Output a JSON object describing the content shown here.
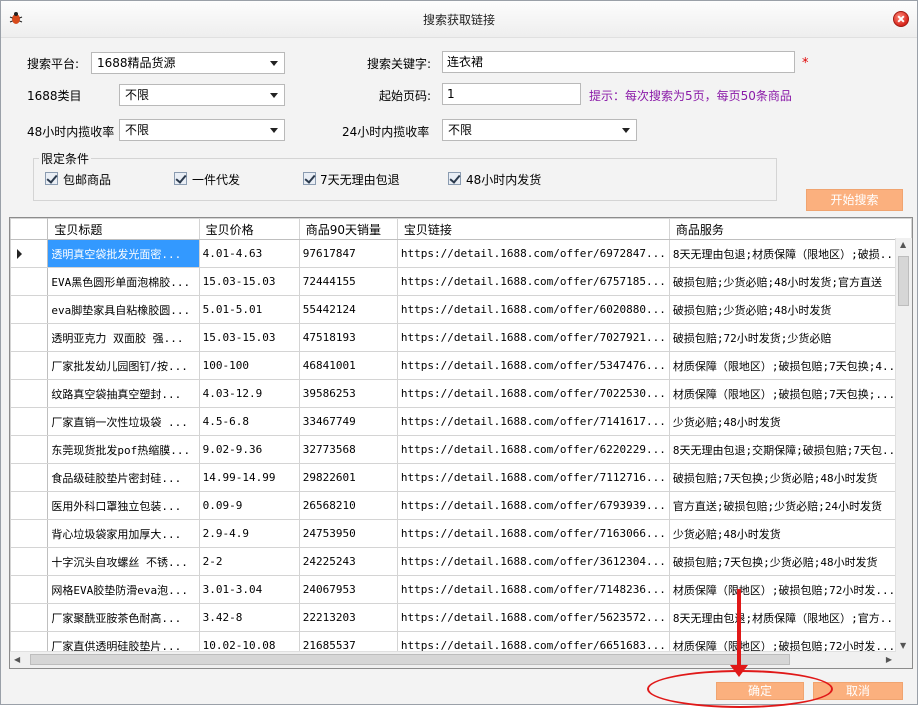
{
  "window": {
    "title": "搜索获取链接"
  },
  "form": {
    "platform_label": "搜索平台:",
    "platform_value": "1688精品货源",
    "keyword_label": "搜索关键字:",
    "keyword_value": "连衣裙",
    "required_mark": "*",
    "category_label": "1688类目",
    "category_value": "不限",
    "start_page_label": "起始页码:",
    "start_page_value": "1",
    "hint": "提示：每次搜索为5页，每页50条商品",
    "rate48_label": "48小时内揽收率",
    "rate48_value": "不限",
    "rate24_label": "24小时内揽收率",
    "rate24_value": "不限"
  },
  "conditions": {
    "title": "限定条件",
    "items": [
      {
        "label": "包邮商品",
        "checked": true
      },
      {
        "label": "一件代发",
        "checked": true
      },
      {
        "label": "7天无理由包退",
        "checked": true
      },
      {
        "label": "48小时内发货",
        "checked": true
      }
    ]
  },
  "start_search_button": "开始搜索",
  "grid": {
    "columns": [
      "宝贝标题",
      "宝贝价格",
      "商品90天销量",
      "宝贝链接",
      "商品服务"
    ],
    "rows": [
      [
        "透明真空袋批发光面密...",
        "4.01-4.63",
        "97617847",
        "https://detail.1688.com/offer/6972847...",
        "8天无理由包退;材质保障（限地区）;破损..."
      ],
      [
        "EVA黑色圆形单面泡棉胶...",
        "15.03-15.03",
        "72444155",
        "https://detail.1688.com/offer/6757185...",
        "破损包赔;少货必赔;48小时发货;官方直送"
      ],
      [
        "eva脚垫家具自粘橡胶圆...",
        "5.01-5.01",
        "55442124",
        "https://detail.1688.com/offer/6020880...",
        "破损包赔;少货必赔;48小时发货"
      ],
      [
        "透明亚克力 双面胶 强...",
        "15.03-15.03",
        "47518193",
        "https://detail.1688.com/offer/7027921...",
        "破损包赔;72小时发货;少货必赔"
      ],
      [
        "厂家批发幼儿园图钉/按...",
        "100-100",
        "46841001",
        "https://detail.1688.com/offer/5347476...",
        "材质保障（限地区）;破损包赔;7天包换;4..."
      ],
      [
        "纹路真空袋抽真空塑封...",
        "4.03-12.9",
        "39586253",
        "https://detail.1688.com/offer/7022530...",
        "材质保障（限地区）;破损包赔;7天包换;..."
      ],
      [
        "厂家直销一次性垃圾袋 ...",
        "4.5-6.8",
        "33467749",
        "https://detail.1688.com/offer/7141617...",
        "少货必赔;48小时发货"
      ],
      [
        "东莞现货批发pof热缩膜...",
        "9.02-9.36",
        "32773568",
        "https://detail.1688.com/offer/6220229...",
        "8天无理由包退;交期保障;破损包赔;7天包..."
      ],
      [
        "食品级硅胶垫片密封硅...",
        "14.99-14.99",
        "29822601",
        "https://detail.1688.com/offer/7112716...",
        "破损包赔;7天包换;少货必赔;48小时发货"
      ],
      [
        "医用外科口罩独立包装...",
        "0.09-9",
        "26568210",
        "https://detail.1688.com/offer/6793939...",
        "官方直送;破损包赔;少货必赔;24小时发货"
      ],
      [
        "背心垃圾袋家用加厚大...",
        "2.9-4.9",
        "24753950",
        "https://detail.1688.com/offer/7163066...",
        "少货必赔;48小时发货"
      ],
      [
        "十字沉头自攻螺丝 不锈...",
        "2-2",
        "24225243",
        "https://detail.1688.com/offer/3612304...",
        "破损包赔;7天包换;少货必赔;48小时发货"
      ],
      [
        "网格EVA胶垫防滑eva泡...",
        "3.01-3.04",
        "24067953",
        "https://detail.1688.com/offer/7148236...",
        "材质保障（限地区）;破损包赔;72小时发..."
      ],
      [
        "厂家聚酰亚胺茶色耐高...",
        "3.42-8",
        "22213203",
        "https://detail.1688.com/offer/5623572...",
        "8天无理由包退;材质保障（限地区）;官方..."
      ],
      [
        "厂家直供透明硅胶垫片...",
        "10.02-10.08",
        "21685537",
        "https://detail.1688.com/offer/6651683...",
        "材质保障（限地区）;破损包赔;72小时发..."
      ]
    ]
  },
  "footer": {
    "ok_label": "确定",
    "cancel_label": "取消"
  },
  "colors": {
    "accent_button": "#fbb07e",
    "selection": "#3399ff",
    "hint": "#8a1aa8",
    "annotation": "#e01818"
  }
}
